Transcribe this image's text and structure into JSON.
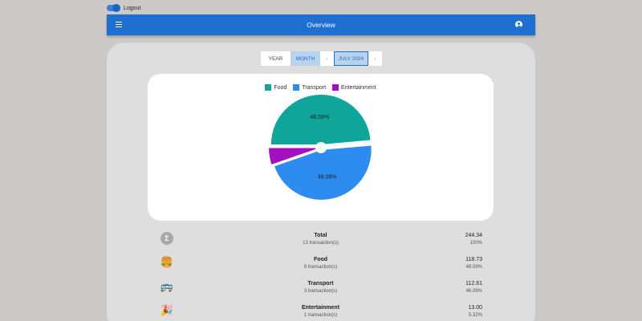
{
  "logout": {
    "label": "Logout"
  },
  "appbar": {
    "title": "Overview"
  },
  "period": {
    "year_label": "YEAR",
    "month_label": "MONTH",
    "prev": "‹",
    "current": "JULY 2024",
    "next": "›"
  },
  "chart_data": {
    "type": "pie",
    "categories": [
      "Food",
      "Transport",
      "Entertainment"
    ],
    "values": [
      118.73,
      112.61,
      13.0
    ],
    "percent_labels": [
      "48.59%",
      "46.09%",
      "5.32%"
    ],
    "colors": [
      "#10a59a",
      "#2e8bf0",
      "#a40fc0"
    ],
    "legend_position": "top"
  },
  "summary": [
    {
      "icon": "sigma-icon",
      "glyph": "Σ",
      "name": "Total",
      "sub": "13 transaction(s)",
      "amount": "244.34",
      "percent": "100%"
    },
    {
      "icon": "burger-icon",
      "glyph": "🍔",
      "name": "Food",
      "sub": "9 transaction(s)",
      "amount": "118.73",
      "percent": "48.59%"
    },
    {
      "icon": "bus-icon",
      "glyph": "🚌",
      "name": "Transport",
      "sub": "3 transaction(s)",
      "amount": "112.61",
      "percent": "46.09%"
    },
    {
      "icon": "party-popper-icon",
      "glyph": "🎉",
      "name": "Entertainment",
      "sub": "1 transaction(s)",
      "amount": "13.00",
      "percent": "5.32%"
    }
  ]
}
